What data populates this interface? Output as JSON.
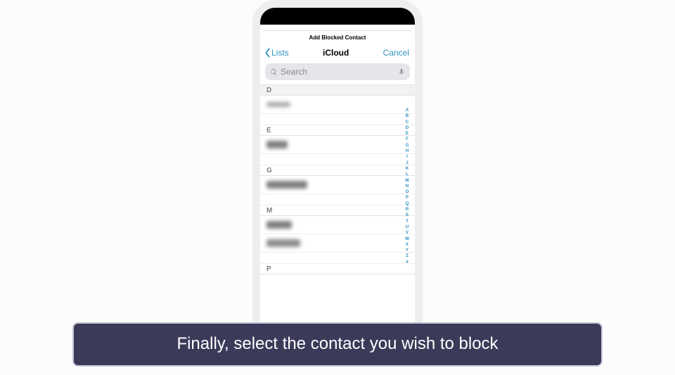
{
  "sheet": {
    "title": "Add Blocked Contact"
  },
  "nav": {
    "back_label": "Lists",
    "title": "iCloud",
    "cancel_label": "Cancel"
  },
  "search": {
    "placeholder": "Search"
  },
  "sections": {
    "d": "D",
    "e": "E",
    "g": "G",
    "m": "M",
    "p": "P"
  },
  "index_letters": [
    "A",
    "B",
    "C",
    "D",
    "E",
    "F",
    "G",
    "H",
    "I",
    "J",
    "K",
    "L",
    "M",
    "N",
    "O",
    "P",
    "Q",
    "R",
    "S",
    "T",
    "U",
    "V",
    "W",
    "X",
    "Y",
    "Z",
    "#"
  ],
  "caption": "Finally, select the contact you wish to block"
}
